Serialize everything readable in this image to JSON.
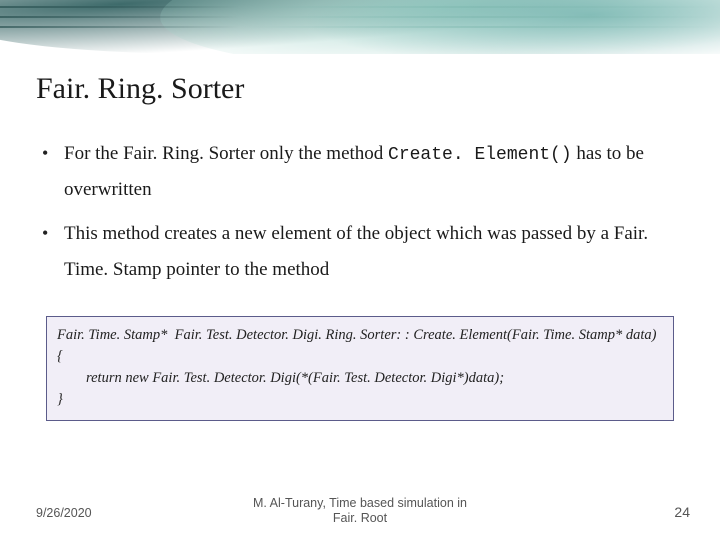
{
  "title": "Fair. Ring. Sorter",
  "bullets": [
    {
      "pre": "For the Fair. Ring. Sorter only the method ",
      "code": "Create. Element()",
      "post": " has to be overwritten"
    },
    {
      "pre": "This method creates a new element of the object which was passed by a Fair. Time. Stamp pointer to the method",
      "code": "",
      "post": ""
    }
  ],
  "code_box": "Fair. Time. Stamp*  Fair. Test. Detector. Digi. Ring. Sorter: : Create. Element(Fair. Time. Stamp* data)\n{\n        return new Fair. Test. Detector. Digi(*(Fair. Test. Detector. Digi*)data);\n}",
  "footer": {
    "date": "9/26/2020",
    "center_line1": "M. Al-Turany, Time based simulation in",
    "center_line2": "Fair. Root",
    "page": "24"
  }
}
